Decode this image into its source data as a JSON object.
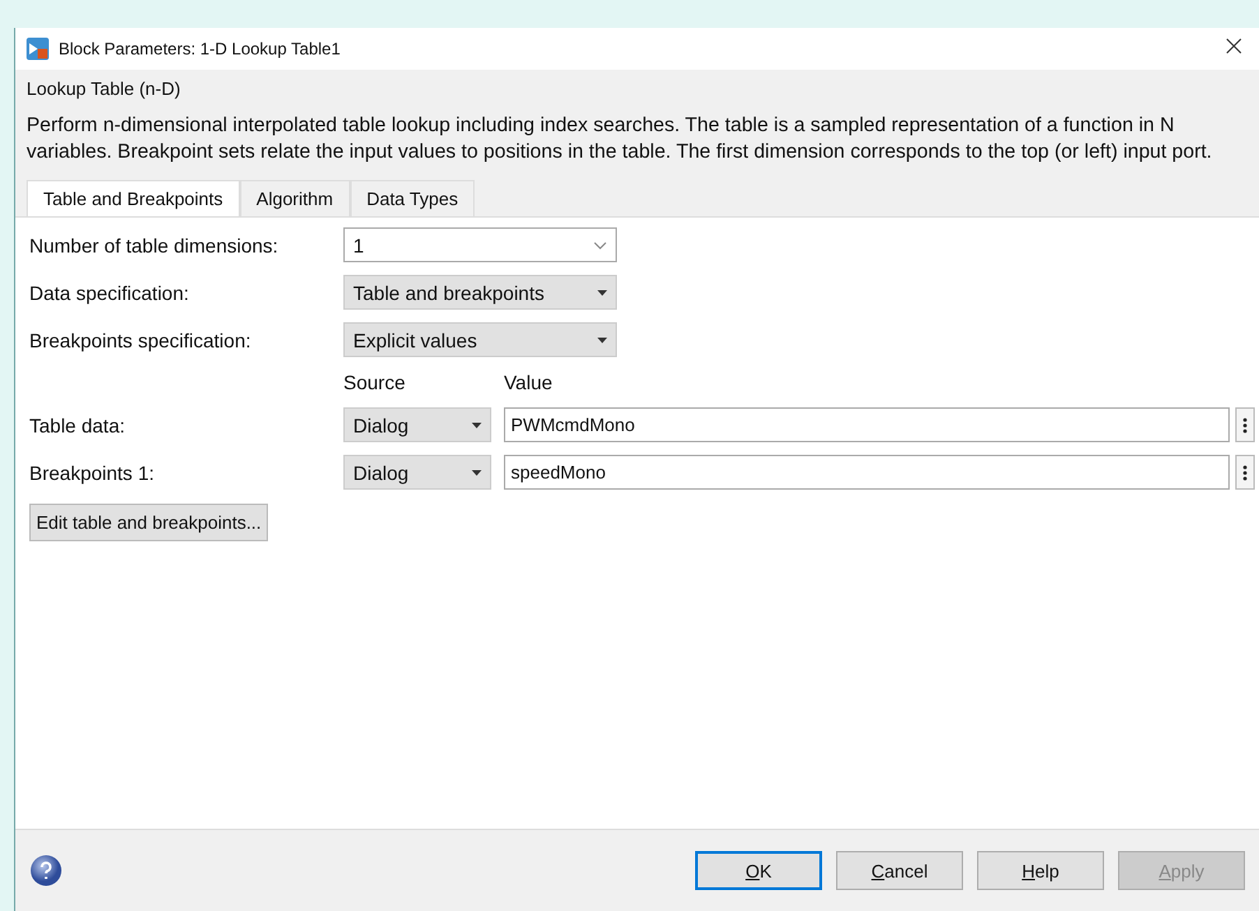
{
  "window": {
    "title": "Block Parameters: 1-D Lookup Table1"
  },
  "group": {
    "title": "Lookup Table (n-D)",
    "description": "Perform n-dimensional interpolated table lookup including index searches. The table is a sampled representation of a function in N variables. Breakpoint sets relate the input values to positions in the table. The first dimension corresponds to the top (or left) input port."
  },
  "tabs": [
    {
      "label": "Table and Breakpoints",
      "selected": true
    },
    {
      "label": "Algorithm",
      "selected": false
    },
    {
      "label": "Data Types",
      "selected": false
    }
  ],
  "settings": [
    {
      "label": "Number of table dimensions:",
      "kind": "combo",
      "value": "1"
    },
    {
      "label": "Data specification:",
      "kind": "dropdown",
      "value": "Table and breakpoints"
    },
    {
      "label": "Breakpoints specification:",
      "kind": "dropdown",
      "value": "Explicit values"
    }
  ],
  "columns": {
    "source": "Source",
    "value": "Value"
  },
  "parameters": [
    {
      "label": "Table data:",
      "source": "Dialog",
      "value": "PWMcmdMono"
    },
    {
      "label": "Breakpoints 1:",
      "source": "Dialog",
      "value": "speedMono"
    }
  ],
  "edit_button": "Edit table and breakpoints...",
  "buttons": [
    {
      "key": "O",
      "rest": "K",
      "disabled": false,
      "default": true
    },
    {
      "key": "C",
      "rest": "ancel",
      "disabled": false,
      "default": false
    },
    {
      "key": "H",
      "rest": "elp",
      "disabled": false,
      "default": false
    },
    {
      "key": "A",
      "rest": "pply",
      "disabled": true,
      "default": false
    }
  ]
}
